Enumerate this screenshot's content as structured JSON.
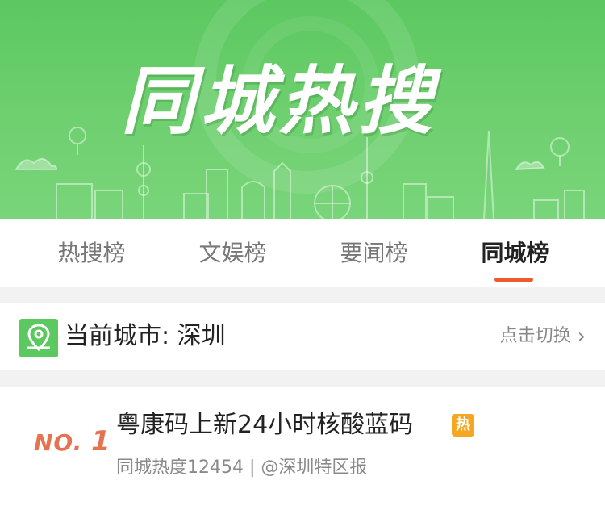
{
  "banner": {
    "title": "同城热搜"
  },
  "tabs": [
    {
      "label": "热搜榜",
      "active": false
    },
    {
      "label": "文娱榜",
      "active": false
    },
    {
      "label": "要闻榜",
      "active": false
    },
    {
      "label": "同城榜",
      "active": true
    }
  ],
  "city": {
    "label": "当前城市: 深圳",
    "switch_label": "点击切换",
    "switch_icon": "chevron-right-icon",
    "icon": "map-pin-icon"
  },
  "items": [
    {
      "rank_prefix": "NO.",
      "rank_number": "1",
      "title": "粤康码上新24小时核酸蓝码",
      "badge": "热",
      "meta": "同城热度12454 | @深圳特区报"
    }
  ],
  "colors": {
    "banner_green": "#5cc860",
    "accent_orange": "#ee5a2a",
    "rank_color": "#e6734f",
    "hot_badge": "#f5a623"
  }
}
